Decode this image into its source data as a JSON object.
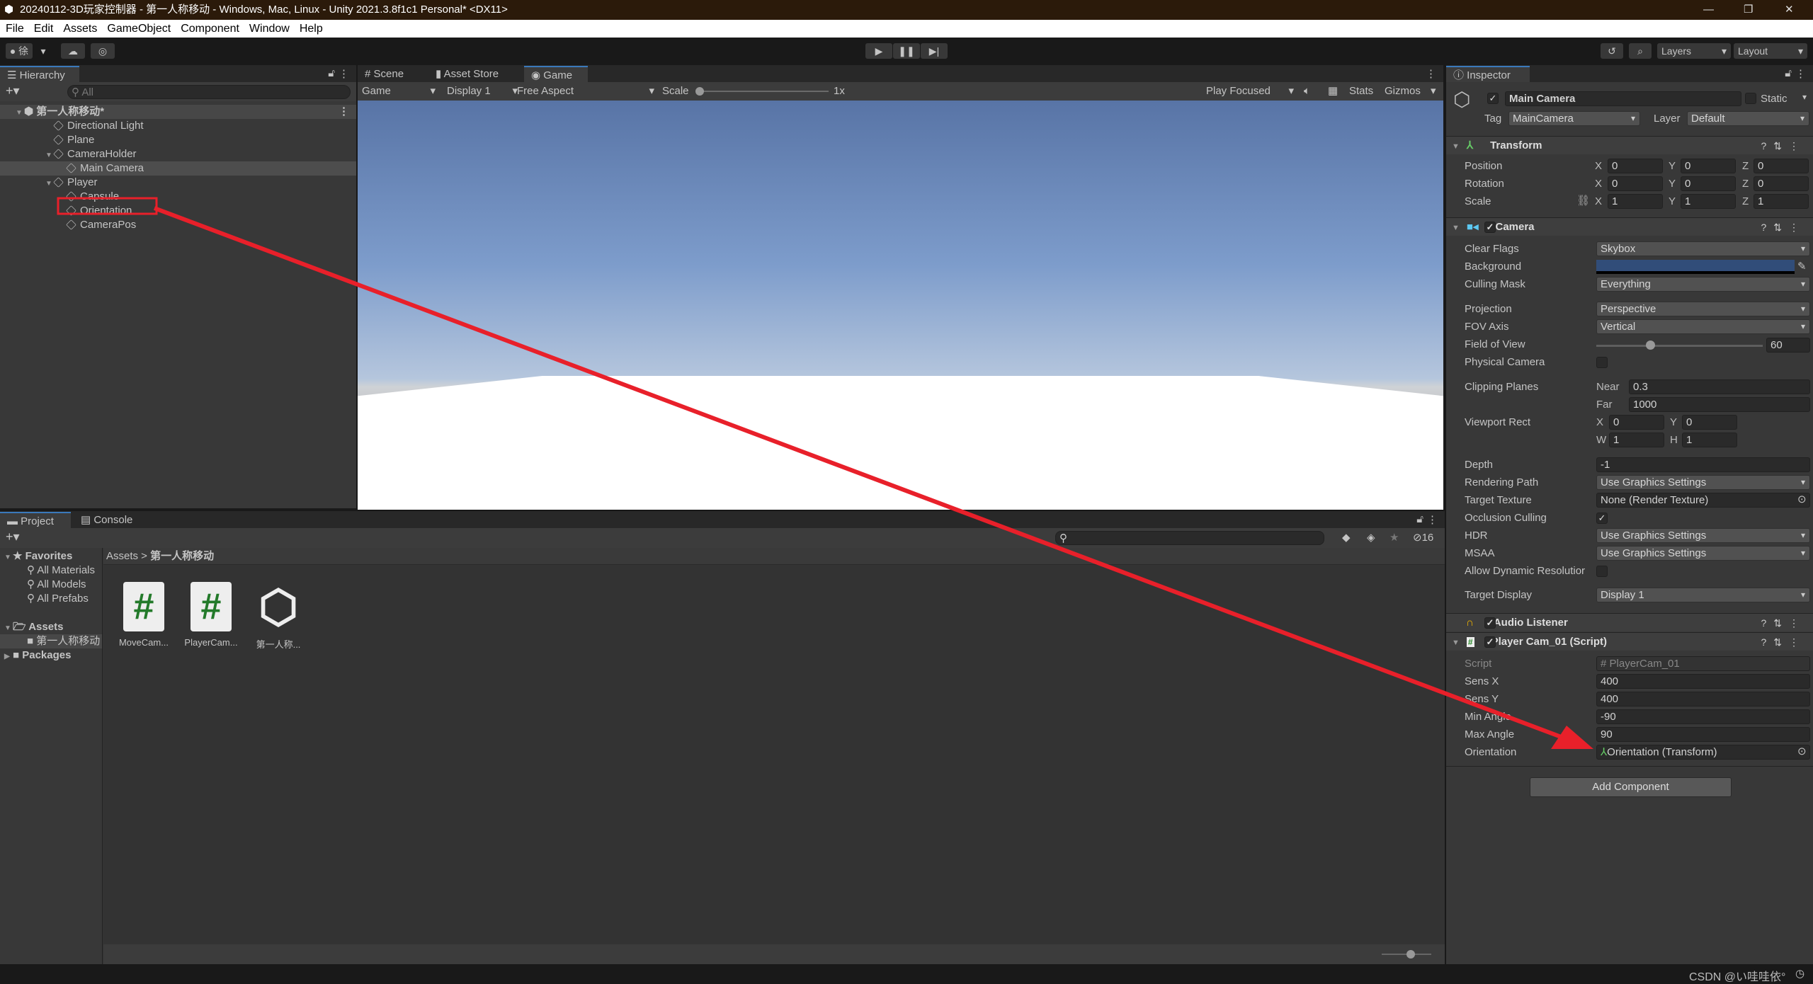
{
  "window": {
    "title": "20240112-3D玩家控制器 - 第一人称移动 - Windows, Mac, Linux - Unity 2021.3.8f1c1 Personal* <DX11>",
    "minimize": "—",
    "restore": "❐",
    "close": "✕"
  },
  "menu": [
    "File",
    "Edit",
    "Assets",
    "GameObject",
    "Component",
    "Window",
    "Help"
  ],
  "toolbar": {
    "account": "徐",
    "layers": "Layers",
    "layout": "Layout"
  },
  "hierarchy": {
    "tab": "Hierarchy",
    "search_placeholder": "All",
    "scene": "第一人称移动*",
    "items": [
      {
        "label": "Directional Light"
      },
      {
        "label": "Plane"
      },
      {
        "label": "CameraHolder"
      },
      {
        "label": "Main Camera",
        "selected": true
      },
      {
        "label": "Player"
      },
      {
        "label": "Capsule"
      },
      {
        "label": "Orientation",
        "highlighted": true
      },
      {
        "label": "CameraPos"
      }
    ]
  },
  "game": {
    "tabs": [
      "Scene",
      "Asset Store",
      "Game"
    ],
    "active_tab": "Game",
    "mode": "Game",
    "display": "Display 1",
    "aspect": "Free Aspect",
    "scale_label": "Scale",
    "scale_value": "1x",
    "play_focused": "Play Focused",
    "stats": "Stats",
    "gizmos": "Gizmos"
  },
  "inspector": {
    "tab": "Inspector",
    "object_name": "Main Camera",
    "active": true,
    "static_label": "Static",
    "tag_label": "Tag",
    "tag": "MainCamera",
    "layer_label": "Layer",
    "layer": "Default",
    "transform": {
      "title": "Transform",
      "position_label": "Position",
      "rotation_label": "Rotation",
      "scale_label": "Scale",
      "position": [
        "0",
        "0",
        "0"
      ],
      "rotation": [
        "0",
        "0",
        "0"
      ],
      "scale": [
        "1",
        "1",
        "1"
      ],
      "axes": [
        "X",
        "Y",
        "Z"
      ]
    },
    "camera": {
      "title": "Camera",
      "clear_flags_label": "Clear Flags",
      "clear_flags": "Skybox",
      "background_label": "Background",
      "background_color": "#314d79",
      "culling_mask_label": "Culling Mask",
      "culling_mask": "Everything",
      "projection_label": "Projection",
      "projection": "Perspective",
      "fov_axis_label": "FOV Axis",
      "fov_axis": "Vertical",
      "fov_label": "Field of View",
      "fov": "60",
      "physical_label": "Physical Camera",
      "clipping_label": "Clipping Planes",
      "near_label": "Near",
      "near": "0.3",
      "far_label": "Far",
      "far": "1000",
      "viewport_label": "Viewport Rect",
      "vp_x": "0",
      "vp_y": "0",
      "vp_w": "1",
      "vp_h": "1",
      "vp_axes": [
        "X",
        "Y",
        "W",
        "H"
      ],
      "depth_label": "Depth",
      "depth": "-1",
      "rendering_label": "Rendering Path",
      "rendering": "Use Graphics Settings",
      "target_texture_label": "Target Texture",
      "target_texture": "None (Render Texture)",
      "occlusion_label": "Occlusion Culling",
      "hdr_label": "HDR",
      "hdr": "Use Graphics Settings",
      "msaa_label": "MSAA",
      "msaa": "Use Graphics Settings",
      "dynres_label": "Allow Dynamic Resolutior",
      "target_display_label": "Target Display",
      "target_display": "Display 1"
    },
    "audio": {
      "title": "Audio Listener"
    },
    "script": {
      "title": "Player Cam_01 (Script)",
      "script_label": "Script",
      "script": "PlayerCam_01",
      "sens_x_label": "Sens X",
      "sens_x": "400",
      "sens_y_label": "Sens Y",
      "sens_y": "400",
      "min_label": "Min Angle",
      "min": "-90",
      "max_label": "Max Angle",
      "max": "90",
      "orientation_label": "Orientation",
      "orientation": "Orientation (Transform)"
    },
    "add_component": "Add Component"
  },
  "project": {
    "tabs": [
      "Project",
      "Console"
    ],
    "favorites": "Favorites",
    "fav_items": [
      "All Materials",
      "All Models",
      "All Prefabs"
    ],
    "assets": "Assets",
    "asset_folder": "第一人称移动",
    "packages": "Packages",
    "breadcrumb_root": "Assets",
    "breadcrumb_current": "第一人称移动",
    "hidden_count": "16",
    "files": [
      {
        "name": "MoveCam...",
        "type": "script"
      },
      {
        "name": "PlayerCam...",
        "type": "script"
      },
      {
        "name": "第一人称...",
        "type": "scene"
      }
    ]
  },
  "watermark": "CSDN @い哇哇依°",
  "annotation_color": "#e8202a"
}
